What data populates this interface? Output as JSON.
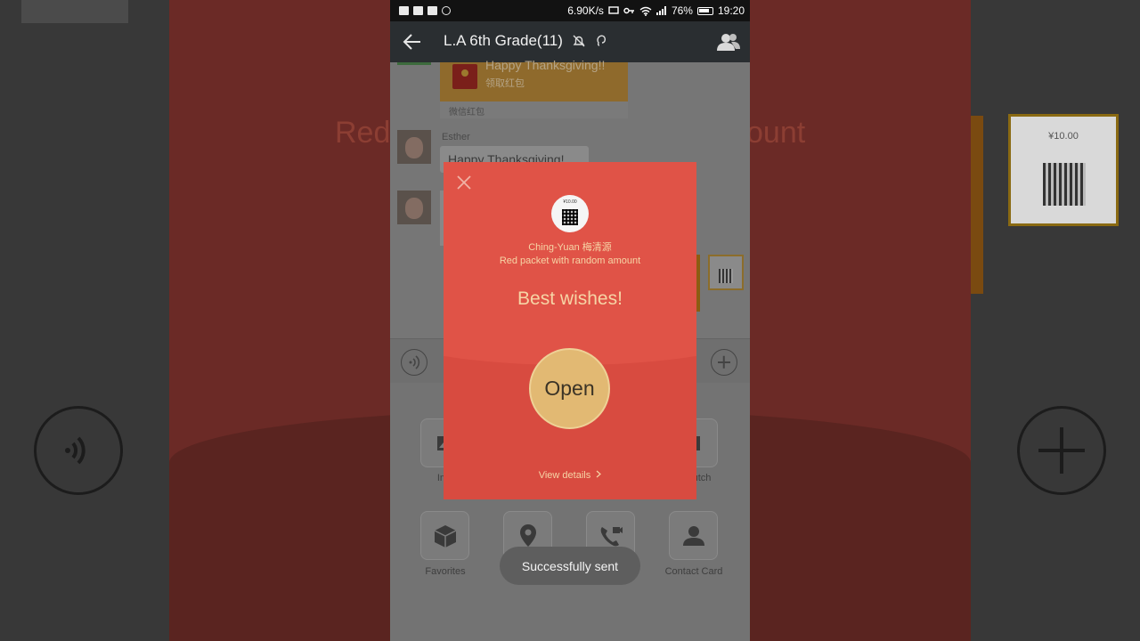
{
  "background": {
    "left_text": "Red",
    "right_text": "ount",
    "ticket_amount": "¥10.00"
  },
  "statusbar": {
    "speed": "6.90K/s",
    "battery": "76%",
    "time": "19:20"
  },
  "navbar": {
    "title": "L.A 6th Grade(11)"
  },
  "chat": {
    "red_packet_title": "Happy Thanksgiving!!",
    "red_packet_sub": "领取红包",
    "red_packet_footer": "微信红包",
    "sender_name": "Esther",
    "message": "Happy Thanksgiving!"
  },
  "panel": {
    "tiles": [
      {
        "label": "Ima",
        "icon": "image-icon"
      },
      {
        "label": "utch",
        "icon": "dutch-icon"
      },
      {
        "label": "Favorites",
        "icon": "cube-icon"
      },
      {
        "label": "",
        "icon": "location-icon"
      },
      {
        "label": "",
        "icon": "video-call-icon"
      },
      {
        "label": "Contact Card",
        "icon": "contact-card-icon"
      }
    ]
  },
  "modal": {
    "sender_amount": "¥10.00",
    "sender": "Ching-Yuan 梅清源",
    "type": "Red packet with random amount",
    "wish": "Best wishes!",
    "open_label": "Open",
    "details_label": "View details",
    "colors": {
      "red": "#e05347",
      "gold": "#e2b973",
      "text": "#f6d5a6"
    }
  },
  "toast": {
    "text": "Successfully sent"
  }
}
